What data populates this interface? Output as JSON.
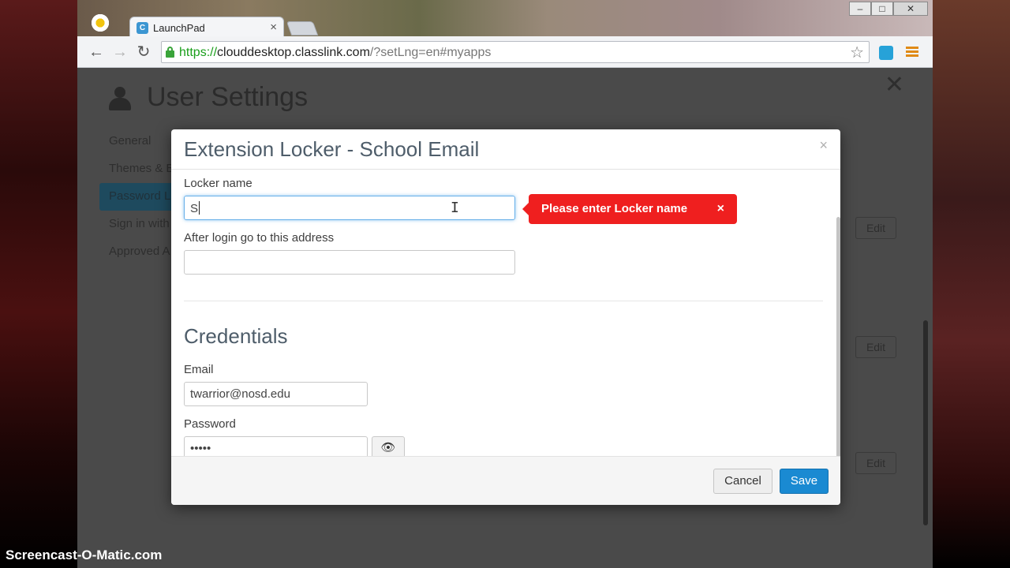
{
  "browser": {
    "tab_title": "LaunchPad",
    "tab_close": "×",
    "url_scheme": "https://",
    "url_host": "clouddesktop.classlink.com",
    "url_rest": "/?setLng=en#myapps",
    "window_buttons": [
      "–",
      "□",
      "✕"
    ]
  },
  "page": {
    "title": "User Settings",
    "close": "✕",
    "sidebar": [
      {
        "label": "General"
      },
      {
        "label": "Themes & B"
      },
      {
        "label": "Password L"
      },
      {
        "label": "Sign in with"
      },
      {
        "label": "Approved A"
      }
    ],
    "edit_label": "Edit"
  },
  "modal": {
    "title": "Extension Locker - School Email",
    "close": "×",
    "locker_name_label": "Locker name",
    "locker_name_value": "S",
    "error_message": "Please enter Locker name",
    "error_close": "×",
    "after_login_label": "After login go to this address",
    "after_login_value": "",
    "credentials_title": "Credentials",
    "email_label": "Email",
    "email_value": "twarrior@nosd.edu",
    "password_label": "Password",
    "password_value": "•••••",
    "cancel_label": "Cancel",
    "save_label": "Save"
  },
  "watermark": "Screencast-O-Matic.com",
  "colors": {
    "primary": "#1a8ad2",
    "error": "#ef1f1f",
    "secure_url": "#199e1a"
  }
}
